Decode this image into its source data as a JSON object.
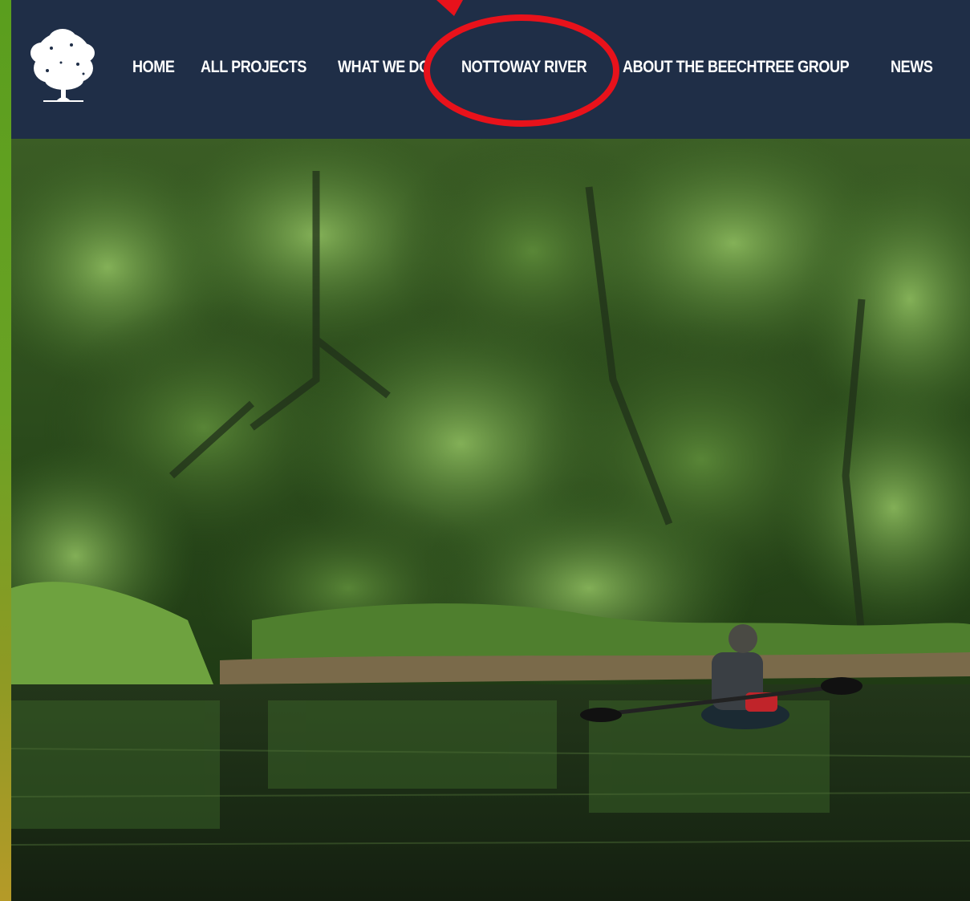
{
  "brand": {
    "logo_icon": "tree-icon"
  },
  "nav": {
    "items": [
      {
        "label": "HOME"
      },
      {
        "label": "ALL PROJECTS"
      },
      {
        "label": "WHAT WE DO"
      },
      {
        "label": "NOTTOWAY RIVER"
      },
      {
        "label": "ABOUT THE BEECHTREE GROUP"
      },
      {
        "label": "NEWS"
      }
    ]
  },
  "colors": {
    "header_bg": "#1f2e47",
    "nav_text": "#ffffff",
    "annotation": "#e8121b",
    "left_bar_top": "#5a9e1e",
    "left_bar_bottom": "#b59a28"
  },
  "annotation": {
    "shape": "ellipse-with-arrow",
    "highlights": "NOTTOWAY RIVER"
  },
  "hero": {
    "subject": "kayaker-on-river-photo"
  }
}
